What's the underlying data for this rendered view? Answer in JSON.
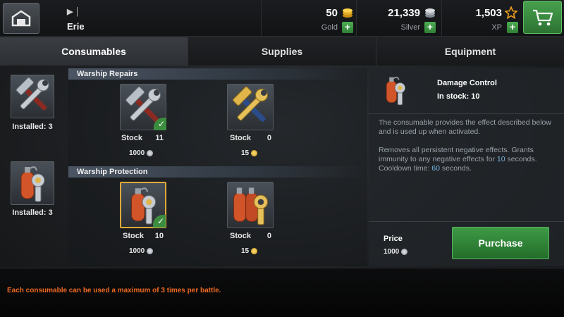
{
  "header": {
    "ship_type": "▶ │",
    "ship_name": "Erie",
    "gold": {
      "value": "50",
      "label": "Gold"
    },
    "silver": {
      "value": "21,339",
      "label": "Silver"
    },
    "xp": {
      "value": "1,503",
      "label": "XP"
    },
    "plus_symbol": "+"
  },
  "tabs": [
    {
      "label": "Consumables",
      "active": true
    },
    {
      "label": "Supplies",
      "active": false
    },
    {
      "label": "Equipment",
      "active": false
    }
  ],
  "installed": [
    {
      "label": "Installed: 3",
      "icon": "repair-tools-icon"
    },
    {
      "label": "Installed: 3",
      "icon": "damage-control-icon"
    }
  ],
  "sections": [
    {
      "title": "Warship Repairs",
      "items": [
        {
          "icon": "repair-tools-icon",
          "stock_label": "Stock",
          "stock": "11",
          "price": "1000",
          "currency": "silver",
          "installed": true,
          "selected": false
        },
        {
          "icon": "repair-tools-gold-icon",
          "stock_label": "Stock",
          "stock": "0",
          "price": "15",
          "currency": "gold",
          "installed": false,
          "selected": false
        }
      ]
    },
    {
      "title": "Warship Protection",
      "items": [
        {
          "icon": "damage-control-icon",
          "stock_label": "Stock",
          "stock": "10",
          "price": "1000",
          "currency": "silver",
          "installed": true,
          "selected": true
        },
        {
          "icon": "damage-control-premium-icon",
          "stock_label": "Stock",
          "stock": "0",
          "price": "15",
          "currency": "gold",
          "installed": false,
          "selected": false
        }
      ]
    }
  ],
  "details": {
    "name": "Damage Control",
    "stock_text": "In stock: 10",
    "desc1": "The consumable provides the effect described below and is used up when activated.",
    "desc2_a": "Removes all persistent negative effects. Grants immunity to any negative effects for ",
    "desc2_num1": "10",
    "desc2_b": " seconds. Cooldown time: ",
    "desc2_num2": "60",
    "desc2_c": " seconds.",
    "price_label": "Price",
    "price_value": "1000",
    "purchase_label": "Purchase"
  },
  "footer": {
    "note": "Each consumable can be used a maximum of 3 times per battle."
  },
  "colors": {
    "accent_green": "#3e9a45",
    "note_orange": "#f06a22",
    "highlight_blue": "#7ab7e6",
    "selected_border": "#e0a93a"
  }
}
